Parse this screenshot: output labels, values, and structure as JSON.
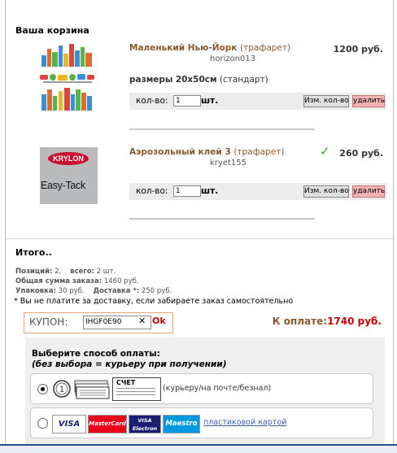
{
  "cart": {
    "title": "Ваша корзина",
    "qty_label": "кол-во:",
    "qty_unit": "шт.",
    "update_label": "Изм. кол-во",
    "delete_label": "удалить",
    "items": [
      {
        "name": "Маленький Нью-Йорк",
        "type": "(трафарет)",
        "code": "horizon013",
        "price": "1200 руб.",
        "size_label": "размеры",
        "size_value": "20x50см",
        "size_type": "(стандарт)",
        "qty": "1"
      },
      {
        "name": "Аэрозольный клей 3",
        "type": "(трафарет)",
        "code": "kryet155",
        "price": "260 руб.",
        "qty": "1",
        "image_brand": "KRYLON",
        "image_text": "Easy-Tack"
      }
    ]
  },
  "totals": {
    "title": "Итого..",
    "positions_label": "Позиций:",
    "positions_value": "2,",
    "total_label": "всего:",
    "total_value": "2 шт.",
    "sum_label": "Общая сумма заказа:",
    "sum_value": "1460 руб.",
    "pack_label": "Упаковка:",
    "pack_value": "30 руб.",
    "delivery_label": "Доставка *:",
    "delivery_value": "250 руб.",
    "note": "* Вы не платите за доставку, если забираете заказ самостоятельно"
  },
  "coupon": {
    "label": "КУПОН:",
    "value": "IHGF0E90",
    "clear": "✕",
    "ok": "Ok"
  },
  "topay": {
    "label": "К оплате:",
    "amount": "1740 руб."
  },
  "payment": {
    "title": "Выберите способ оплаты:",
    "subtitle": "(без выбора = курьеру при получении)",
    "cash_tag": "СЧЕТ",
    "cash_text": "(курьеру/на почте/безнал)",
    "card_link": "пластиковой картой",
    "cards": [
      "VISA",
      "MasterCard",
      "VISA Electron",
      "Maestro"
    ]
  }
}
